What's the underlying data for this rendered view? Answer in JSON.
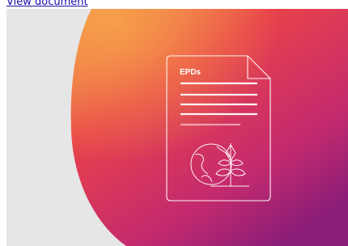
{
  "link": {
    "text": "View document"
  },
  "card": {
    "doc_title": "EPDs",
    "icon": "document-leaf-globe-icon",
    "colors": {
      "background": "#e6e6e6",
      "gradient_orange": "#f29247",
      "gradient_red": "#e8424a",
      "gradient_magenta": "#b4247a",
      "gradient_purple": "#8a1d78",
      "line": "#ffffff"
    }
  }
}
